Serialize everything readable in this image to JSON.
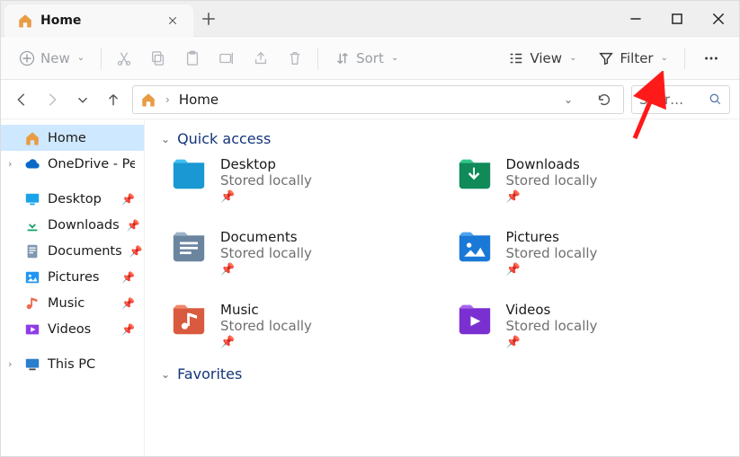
{
  "tab": {
    "label": "Home"
  },
  "toolbar": {
    "new": "New",
    "sort": "Sort",
    "view": "View",
    "filter": "Filter"
  },
  "address": {
    "crumb": "Home",
    "search_placeholder": "Search Home"
  },
  "sidebar": {
    "home": "Home",
    "onedrive": "OneDrive - Personal",
    "desktop": "Desktop",
    "downloads": "Downloads",
    "documents": "Documents",
    "pictures": "Pictures",
    "music": "Music",
    "videos": "Videos",
    "thispc": "This PC"
  },
  "sections": {
    "quickaccess": "Quick access",
    "favorites": "Favorites"
  },
  "quickaccess": [
    {
      "name": "Desktop",
      "sub": "Stored locally",
      "color": "#1aa3e8"
    },
    {
      "name": "Downloads",
      "sub": "Stored locally",
      "color": "#17a36d"
    },
    {
      "name": "Documents",
      "sub": "Stored locally",
      "color": "#7f97b0"
    },
    {
      "name": "Pictures",
      "sub": "Stored locally",
      "color": "#2196f3"
    },
    {
      "name": "Music",
      "sub": "Stored locally",
      "color": "#ed6b4d"
    },
    {
      "name": "Videos",
      "sub": "Stored locally",
      "color": "#8e3de6"
    }
  ]
}
